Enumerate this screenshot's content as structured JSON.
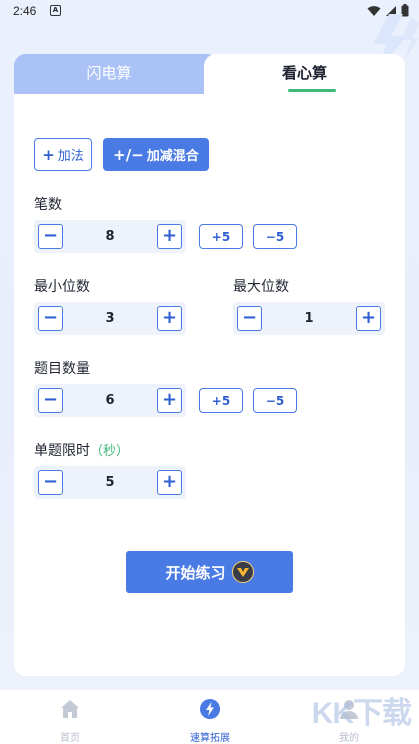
{
  "status_bar": {
    "time": "2:46",
    "app_badge": "A"
  },
  "tabs": [
    {
      "label": "闪电算",
      "active": false
    },
    {
      "label": "看心算",
      "active": true
    }
  ],
  "operations": {
    "add": {
      "symbol": "+",
      "label": "加法",
      "selected": false
    },
    "mix": {
      "symbol": "+/−",
      "label": "加减混合",
      "selected": true
    }
  },
  "settings": {
    "strokes": {
      "label": "笔数",
      "value": "8",
      "quick_plus": "+5",
      "quick_minus": "−5"
    },
    "min_digits": {
      "label": "最小位数",
      "value": "3"
    },
    "max_digits": {
      "label": "最大位数",
      "value": "1"
    },
    "question_count": {
      "label": "题目数量",
      "value": "6",
      "quick_plus": "+5",
      "quick_minus": "−5"
    },
    "time_limit": {
      "label": "单题限时",
      "unit": "（秒）",
      "value": "5"
    }
  },
  "stepper_symbols": {
    "minus": "−",
    "plus": "+"
  },
  "start_button": {
    "label": "开始练习"
  },
  "bottom_nav": [
    {
      "label": "首页",
      "icon": "home-icon",
      "active": false
    },
    {
      "label": "速算拓展",
      "icon": "lightning-icon",
      "active": true
    },
    {
      "label": "我的",
      "icon": "user-icon",
      "active": false
    }
  ],
  "watermark": "KK下载",
  "colors": {
    "primary": "#4a7be4",
    "accent_green": "#3fb87a",
    "tab_inactive": "#aac2f5"
  }
}
